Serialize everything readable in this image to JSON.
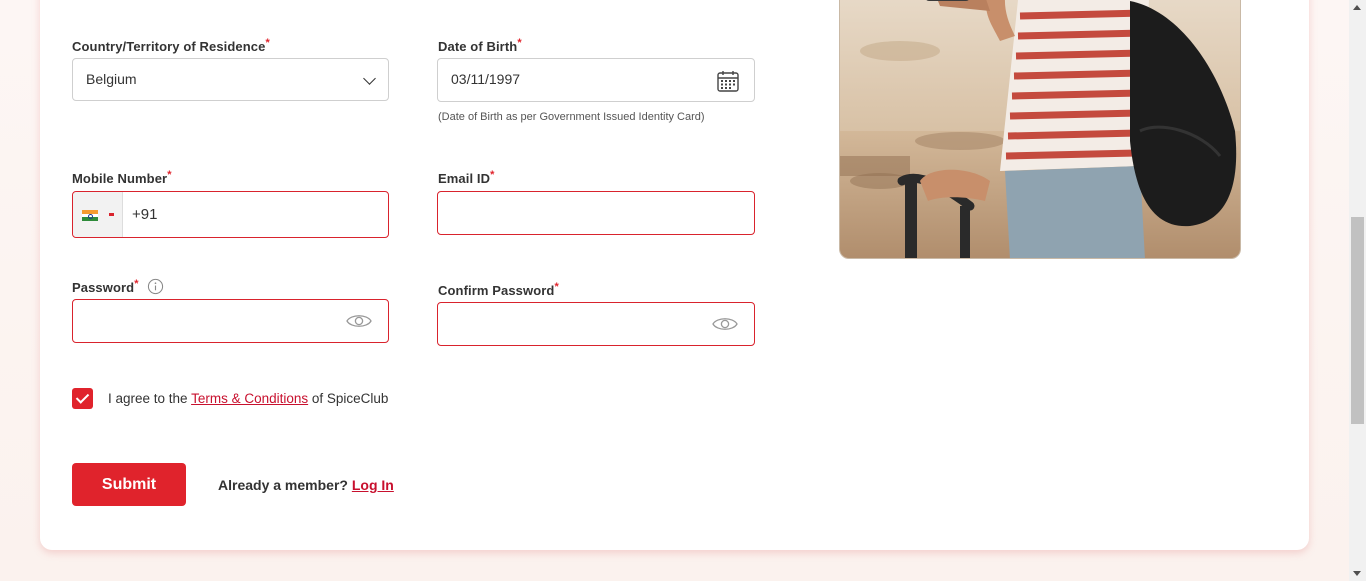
{
  "form": {
    "country": {
      "label": "Country/Territory of Residence",
      "value": "Belgium"
    },
    "dob": {
      "label": "Date of Birth",
      "value": "03/11/1997",
      "hint": "(Date of Birth as per Government Issued Identity Card)"
    },
    "mobile": {
      "label": "Mobile Number",
      "code": "+91"
    },
    "email": {
      "label": "Email ID",
      "value": ""
    },
    "password": {
      "label": "Password",
      "value": ""
    },
    "confirm_password": {
      "label": "Confirm Password",
      "value": ""
    },
    "required_mark": "*",
    "agree": {
      "prefix": "I agree to the ",
      "link": "Terms & Conditions",
      "suffix": " of SpiceClub",
      "checked": true
    },
    "submit_label": "Submit",
    "member": {
      "text": "Already a member? ",
      "link": "Log In"
    }
  },
  "icons": {
    "dropdown": "chevron-down-icon",
    "calendar": "calendar-icon",
    "flag": "india-flag-icon",
    "eye": "eye-icon",
    "info": "info-icon",
    "check": "check-icon"
  },
  "colors": {
    "accent": "#e0232c",
    "link": "#c8102e",
    "error_border": "#d9232d"
  }
}
